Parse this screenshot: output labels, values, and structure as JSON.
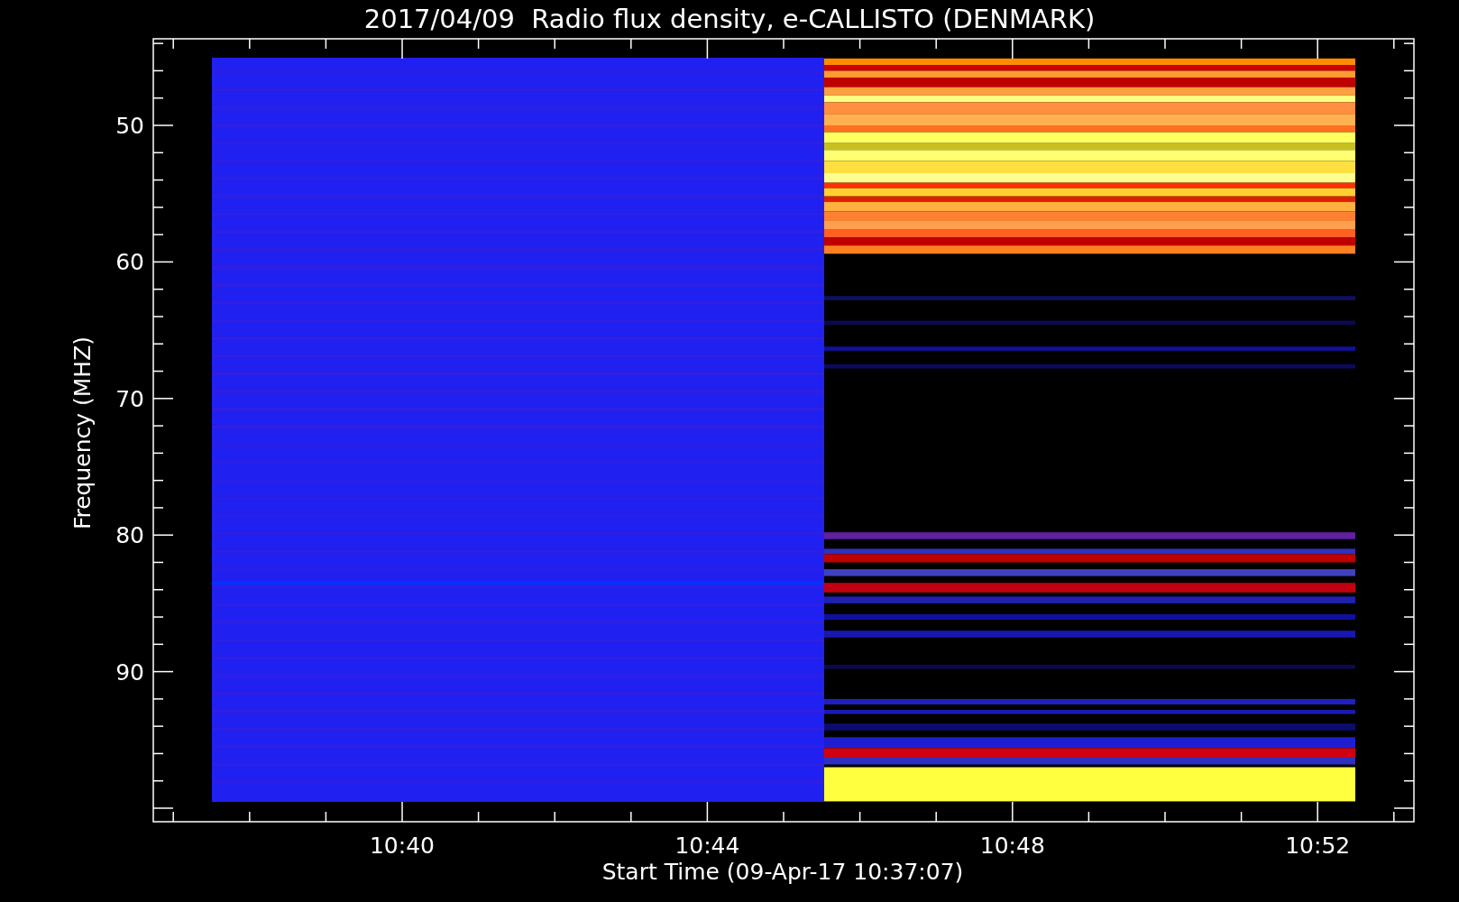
{
  "title": "2017/04/09  Radio flux density, e-CALLISTO (DENMARK)",
  "y_axis": {
    "label": "Frequency (MHZ)",
    "ticks": [
      "50",
      "60",
      "70",
      "80",
      "90"
    ]
  },
  "x_axis": {
    "label": "Start Time (09-Apr-17 10:37:07)",
    "ticks": [
      "10:40",
      "10:44",
      "10:48",
      "10:52"
    ]
  }
}
